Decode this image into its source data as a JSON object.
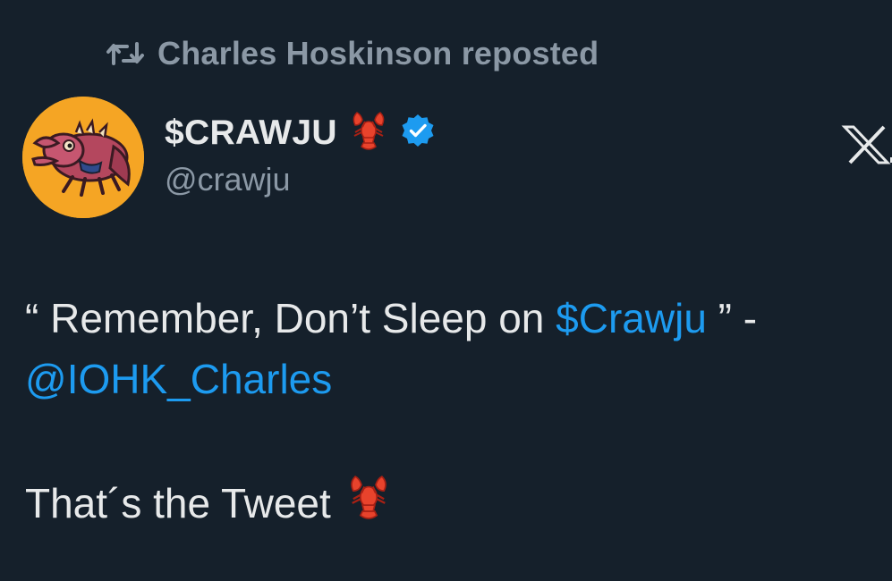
{
  "repost": {
    "icon": "repost-icon",
    "text": "Charles Hoskinson reposted"
  },
  "author": {
    "display_name": "$CRAWJU",
    "name_emoji": "lobster-emoji",
    "verified_icon": "verified-badge-icon",
    "handle": "@crawju",
    "avatar": "crawju-lobster-avatar"
  },
  "brand": {
    "logo": "x-logo-icon"
  },
  "tweet": {
    "part1": "“ Remember, Don’t Sleep on ",
    "cashtag": "$Crawju",
    "part2": " ” -",
    "mention": "@IOHK_Charles",
    "closing": "That´s the Tweet",
    "closing_emoji": "lobster-emoji"
  },
  "colors": {
    "background": "#15202b",
    "primary_text": "#e7e9ea",
    "secondary_text": "#8b98a5",
    "link": "#1d9bf0",
    "verified": "#1d9bf0",
    "avatar_bg": "#f5a524"
  }
}
